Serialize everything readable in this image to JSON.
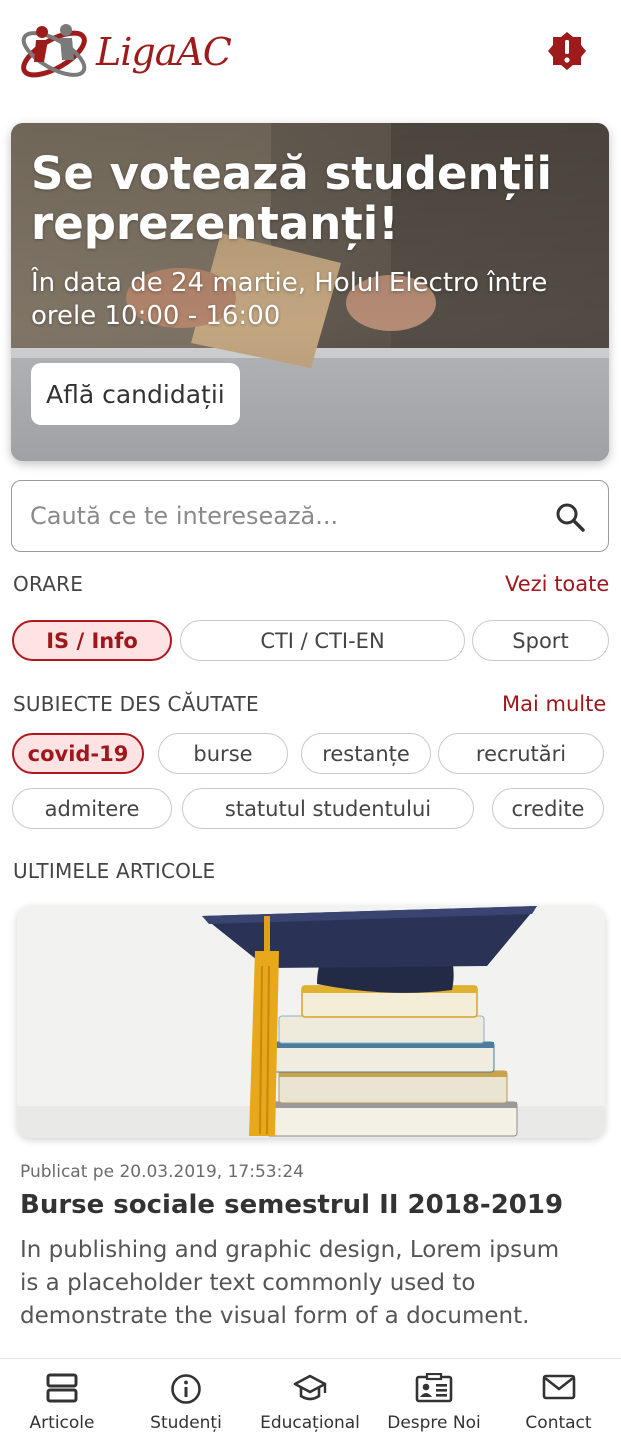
{
  "header": {
    "logo_text": "LigaAC",
    "alert_icon": "alert-octagon-icon",
    "brand_color": "#9e1b1b"
  },
  "hero": {
    "title": "Se votează studenții reprezentanți!",
    "subtitle": "În data de 24 martie, Holul Electro între orele 10:00 - 16:00",
    "button_label": "Află candidații"
  },
  "search": {
    "placeholder": "Caută ce te interesează...",
    "icon": "search-icon"
  },
  "schedules": {
    "title": "ORARE",
    "link": "Vezi toate",
    "chips": [
      {
        "label": "IS / Info",
        "active": true
      },
      {
        "label": "CTI / CTI-EN",
        "active": false
      },
      {
        "label": "Sport",
        "active": false
      }
    ]
  },
  "topics": {
    "title": "SUBIECTE DES CĂUTATE",
    "link": "Mai multe",
    "chips": [
      {
        "label": "covid-19",
        "active": true
      },
      {
        "label": "burse",
        "active": false
      },
      {
        "label": "restanțe",
        "active": false
      },
      {
        "label": "recrutări",
        "active": false
      },
      {
        "label": "admitere",
        "active": false
      },
      {
        "label": "statutul studentului",
        "active": false
      },
      {
        "label": "credite",
        "active": false
      }
    ]
  },
  "articles": {
    "title": "ULTIMELE ARTICOLE",
    "items": [
      {
        "date": "Publicat pe 20.03.2019, 17:53:24",
        "title": "Burse sociale semestrul II 2018-2019",
        "body": "In publishing and graphic design, Lorem ipsum is a placeholder text commonly used to demonstrate the visual form of a document."
      }
    ]
  },
  "bottom_nav": {
    "items": [
      {
        "label": "Articole",
        "icon": "articles-icon"
      },
      {
        "label": "Studenți",
        "icon": "info-icon"
      },
      {
        "label": "Educațional",
        "icon": "graduation-cap-icon"
      },
      {
        "label": "Despre Noi",
        "icon": "id-card-icon"
      },
      {
        "label": "Contact",
        "icon": "mail-icon"
      }
    ]
  },
  "colors": {
    "accent": "#a0171b",
    "chip_active_bg": "#fde3e4",
    "chip_border": "#c9c9c9"
  }
}
